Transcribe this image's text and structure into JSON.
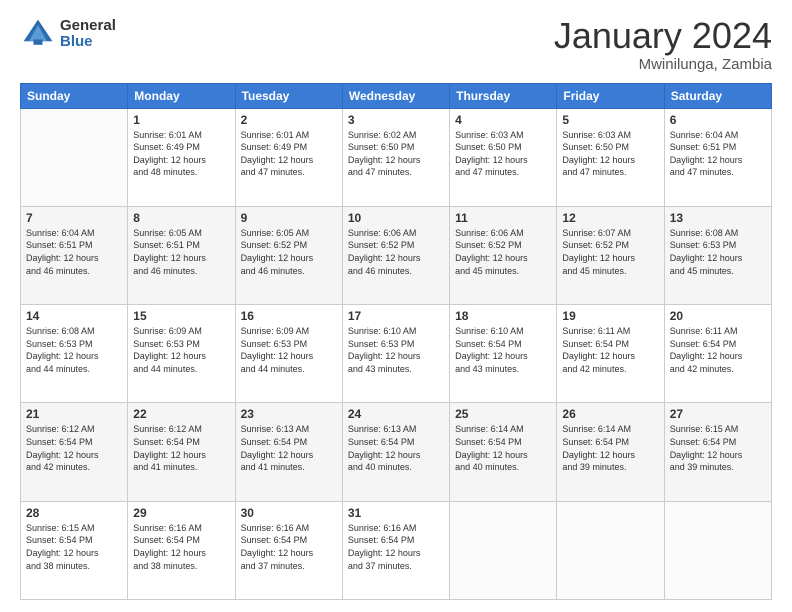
{
  "logo": {
    "general": "General",
    "blue": "Blue"
  },
  "header": {
    "month": "January 2024",
    "location": "Mwinilunga, Zambia"
  },
  "days_of_week": [
    "Sunday",
    "Monday",
    "Tuesday",
    "Wednesday",
    "Thursday",
    "Friday",
    "Saturday"
  ],
  "weeks": [
    [
      {
        "day": "",
        "info": ""
      },
      {
        "day": "1",
        "info": "Sunrise: 6:01 AM\nSunset: 6:49 PM\nDaylight: 12 hours\nand 48 minutes."
      },
      {
        "day": "2",
        "info": "Sunrise: 6:01 AM\nSunset: 6:49 PM\nDaylight: 12 hours\nand 47 minutes."
      },
      {
        "day": "3",
        "info": "Sunrise: 6:02 AM\nSunset: 6:50 PM\nDaylight: 12 hours\nand 47 minutes."
      },
      {
        "day": "4",
        "info": "Sunrise: 6:03 AM\nSunset: 6:50 PM\nDaylight: 12 hours\nand 47 minutes."
      },
      {
        "day": "5",
        "info": "Sunrise: 6:03 AM\nSunset: 6:50 PM\nDaylight: 12 hours\nand 47 minutes."
      },
      {
        "day": "6",
        "info": "Sunrise: 6:04 AM\nSunset: 6:51 PM\nDaylight: 12 hours\nand 47 minutes."
      }
    ],
    [
      {
        "day": "7",
        "info": "Sunrise: 6:04 AM\nSunset: 6:51 PM\nDaylight: 12 hours\nand 46 minutes."
      },
      {
        "day": "8",
        "info": "Sunrise: 6:05 AM\nSunset: 6:51 PM\nDaylight: 12 hours\nand 46 minutes."
      },
      {
        "day": "9",
        "info": "Sunrise: 6:05 AM\nSunset: 6:52 PM\nDaylight: 12 hours\nand 46 minutes."
      },
      {
        "day": "10",
        "info": "Sunrise: 6:06 AM\nSunset: 6:52 PM\nDaylight: 12 hours\nand 46 minutes."
      },
      {
        "day": "11",
        "info": "Sunrise: 6:06 AM\nSunset: 6:52 PM\nDaylight: 12 hours\nand 45 minutes."
      },
      {
        "day": "12",
        "info": "Sunrise: 6:07 AM\nSunset: 6:52 PM\nDaylight: 12 hours\nand 45 minutes."
      },
      {
        "day": "13",
        "info": "Sunrise: 6:08 AM\nSunset: 6:53 PM\nDaylight: 12 hours\nand 45 minutes."
      }
    ],
    [
      {
        "day": "14",
        "info": "Sunrise: 6:08 AM\nSunset: 6:53 PM\nDaylight: 12 hours\nand 44 minutes."
      },
      {
        "day": "15",
        "info": "Sunrise: 6:09 AM\nSunset: 6:53 PM\nDaylight: 12 hours\nand 44 minutes."
      },
      {
        "day": "16",
        "info": "Sunrise: 6:09 AM\nSunset: 6:53 PM\nDaylight: 12 hours\nand 44 minutes."
      },
      {
        "day": "17",
        "info": "Sunrise: 6:10 AM\nSunset: 6:53 PM\nDaylight: 12 hours\nand 43 minutes."
      },
      {
        "day": "18",
        "info": "Sunrise: 6:10 AM\nSunset: 6:54 PM\nDaylight: 12 hours\nand 43 minutes."
      },
      {
        "day": "19",
        "info": "Sunrise: 6:11 AM\nSunset: 6:54 PM\nDaylight: 12 hours\nand 42 minutes."
      },
      {
        "day": "20",
        "info": "Sunrise: 6:11 AM\nSunset: 6:54 PM\nDaylight: 12 hours\nand 42 minutes."
      }
    ],
    [
      {
        "day": "21",
        "info": "Sunrise: 6:12 AM\nSunset: 6:54 PM\nDaylight: 12 hours\nand 42 minutes."
      },
      {
        "day": "22",
        "info": "Sunrise: 6:12 AM\nSunset: 6:54 PM\nDaylight: 12 hours\nand 41 minutes."
      },
      {
        "day": "23",
        "info": "Sunrise: 6:13 AM\nSunset: 6:54 PM\nDaylight: 12 hours\nand 41 minutes."
      },
      {
        "day": "24",
        "info": "Sunrise: 6:13 AM\nSunset: 6:54 PM\nDaylight: 12 hours\nand 40 minutes."
      },
      {
        "day": "25",
        "info": "Sunrise: 6:14 AM\nSunset: 6:54 PM\nDaylight: 12 hours\nand 40 minutes."
      },
      {
        "day": "26",
        "info": "Sunrise: 6:14 AM\nSunset: 6:54 PM\nDaylight: 12 hours\nand 39 minutes."
      },
      {
        "day": "27",
        "info": "Sunrise: 6:15 AM\nSunset: 6:54 PM\nDaylight: 12 hours\nand 39 minutes."
      }
    ],
    [
      {
        "day": "28",
        "info": "Sunrise: 6:15 AM\nSunset: 6:54 PM\nDaylight: 12 hours\nand 38 minutes."
      },
      {
        "day": "29",
        "info": "Sunrise: 6:16 AM\nSunset: 6:54 PM\nDaylight: 12 hours\nand 38 minutes."
      },
      {
        "day": "30",
        "info": "Sunrise: 6:16 AM\nSunset: 6:54 PM\nDaylight: 12 hours\nand 37 minutes."
      },
      {
        "day": "31",
        "info": "Sunrise: 6:16 AM\nSunset: 6:54 PM\nDaylight: 12 hours\nand 37 minutes."
      },
      {
        "day": "",
        "info": ""
      },
      {
        "day": "",
        "info": ""
      },
      {
        "day": "",
        "info": ""
      }
    ]
  ]
}
